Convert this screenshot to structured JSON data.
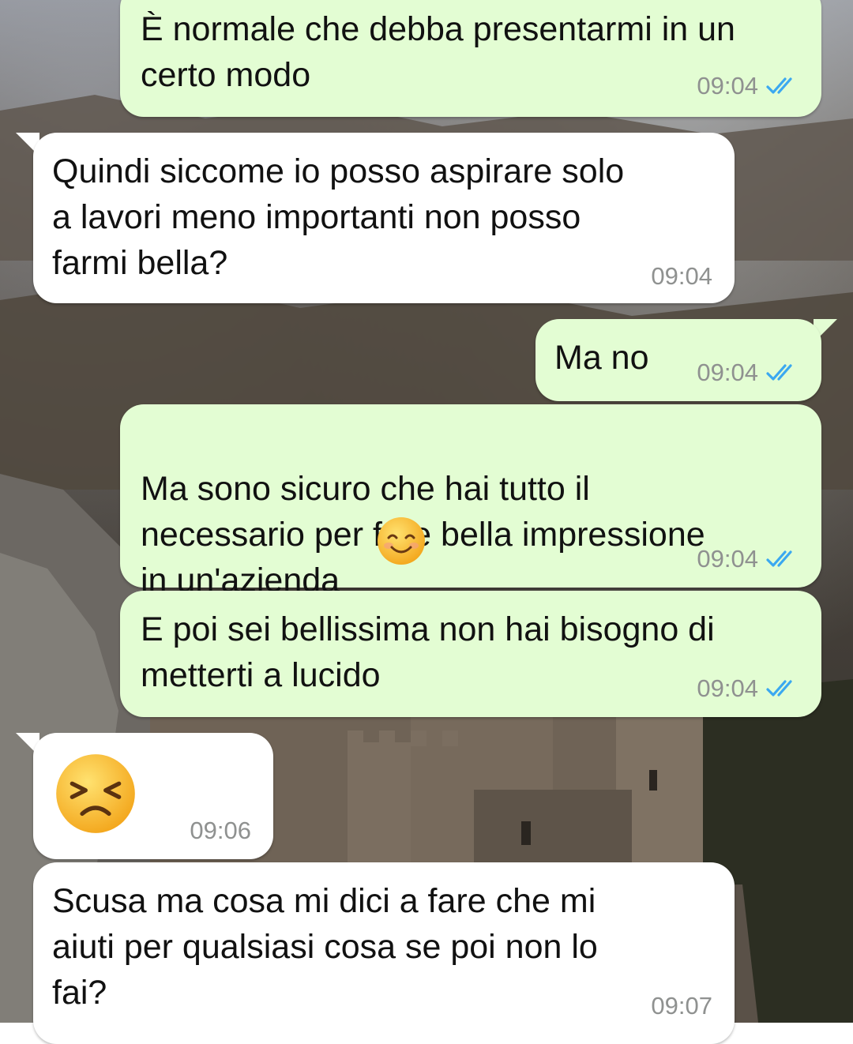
{
  "chat": {
    "messages": [
      {
        "direction": "outgoing",
        "text": "È normale che debba presentarmi in un\ncerto modo",
        "time": "09:04",
        "status": "read"
      },
      {
        "direction": "incoming",
        "text": "Quindi siccome io posso aspirare solo\na lavori meno importanti non posso\nfarmi bella?",
        "time": "09:04"
      },
      {
        "direction": "outgoing",
        "text": "Ma no",
        "time": "09:04",
        "status": "read"
      },
      {
        "direction": "outgoing",
        "text": "Ma sono sicuro che hai tutto il\nnecessario per fare bella impressione\nin un'azienda",
        "emoji": "smiling-face-icon",
        "time": "09:04",
        "status": "read"
      },
      {
        "direction": "outgoing",
        "text": "E poi sei bellissima non hai bisogno di\nmetterti a lucido",
        "time": "09:04",
        "status": "read"
      },
      {
        "direction": "incoming",
        "emoji": "persevering-face-icon",
        "time": "09:06"
      },
      {
        "direction": "incoming",
        "text": "Scusa ma cosa mi dici a fare che mi\naiuti per qualsiasi cosa se poi non lo\nfai?",
        "time": "09:07"
      }
    ]
  },
  "colors": {
    "outgoing_bubble": "#e3fdd3",
    "incoming_bubble": "#ffffff",
    "read_ticks": "#3ba8f0",
    "timestamp": "#8f9190"
  }
}
